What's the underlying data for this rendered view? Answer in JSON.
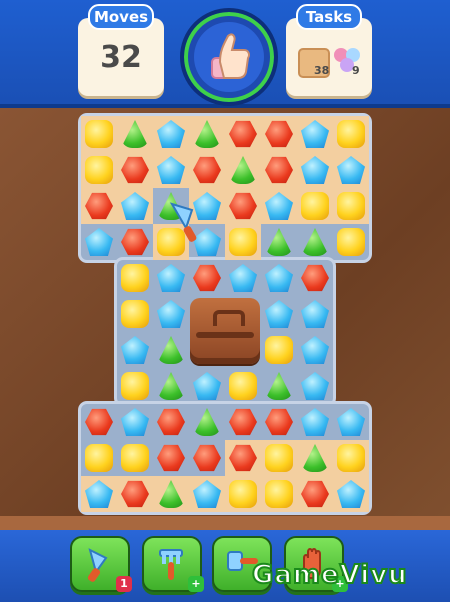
{
  "hud": {
    "moves_label": "Moves",
    "moves_value": "32",
    "tasks_label": "Tasks",
    "tasks": [
      {
        "icon": "sand-tile-icon",
        "count": "38"
      },
      {
        "icon": "bubble-cluster-icon",
        "count": "9"
      }
    ],
    "goal_icon": "thumbs-up-icon",
    "goal_ring_color": "#3ed14a"
  },
  "boosters": [
    {
      "name": "trowel-booster",
      "icon": "trowel-icon",
      "badge": "1",
      "badge_color": "#e0304a"
    },
    {
      "name": "rake-booster",
      "icon": "rake-icon",
      "badge": "+",
      "badge_color": "#2fbf3a"
    },
    {
      "name": "hammer-booster",
      "icon": "hammer-icon",
      "badge": "",
      "badge_color": ""
    },
    {
      "name": "glove-booster",
      "icon": "glove-icon",
      "badge": "+",
      "badge_color": "#2fbf3a"
    }
  ],
  "board": {
    "rows": [
      "YGBGRRBY",
      "YRBRGRBB",
      "RBGBRBYY",
      "BRYBYGGY",
      "-YBRBBR-",
      "-YB##BB-",
      "-BG##YB-",
      "-YGBYGB-",
      "RBRGRRBB",
      "YYRRRYGY",
      "BRGBYYRB"
    ],
    "sand": [
      "11111111",
      "11111111",
      "11011111",
      "00101000",
      "00000000",
      "00000000",
      "00000000",
      "00000000",
      "00000000",
      "00001111",
      "11111111"
    ]
  },
  "watermark": "GameVivu"
}
